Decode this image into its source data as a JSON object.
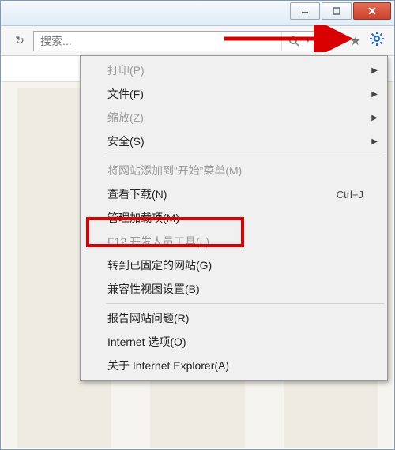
{
  "search": {
    "placeholder": "搜索..."
  },
  "menu": {
    "print": "打印(P)",
    "file": "文件(F)",
    "zoom": "缩放(Z)",
    "safety": "安全(S)",
    "addToStart": "将网站添加到“开始”菜单(M)",
    "viewDownloads": "查看下载(N)",
    "viewDownloadsShortcut": "Ctrl+J",
    "manageAddons": "管理加载项(M)",
    "f12Tools": "F12 开发人员工具(L)",
    "goToPinned": "转到已固定的网站(G)",
    "compatView": "兼容性视图设置(B)",
    "reportProblem": "报告网站问题(R)",
    "internetOptions": "Internet 选项(O)",
    "aboutIE": "关于 Internet Explorer(A)"
  },
  "annotation_color": "#d80000"
}
